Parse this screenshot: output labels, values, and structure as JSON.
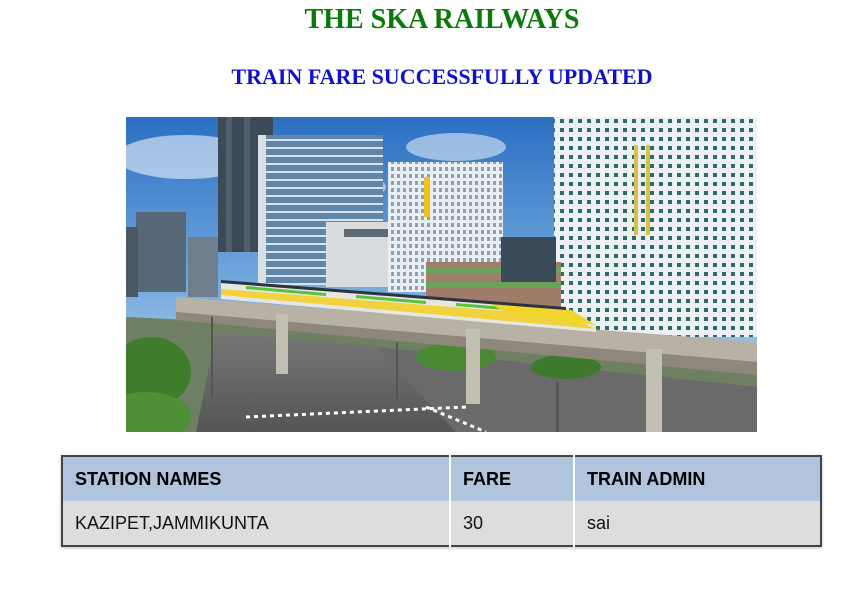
{
  "page": {
    "title": "THE SKA RAILWAYS",
    "status_message": "TRAIN FARE SUCCESSFULLY UPDATED"
  },
  "hero_image": {
    "subject": "elevated train passing city skyscrapers"
  },
  "fare_table": {
    "headers": [
      "STATION NAMES",
      "FARE",
      "TRAIN ADMIN"
    ],
    "rows": [
      [
        "KAZIPET,JAMMIKUNTA",
        "30",
        "sai"
      ]
    ]
  },
  "colors": {
    "title": "#0a7a0a",
    "status": "#1010cc",
    "table_header_bg": "#b0c4de",
    "table_row_bg": "#dddddd"
  }
}
